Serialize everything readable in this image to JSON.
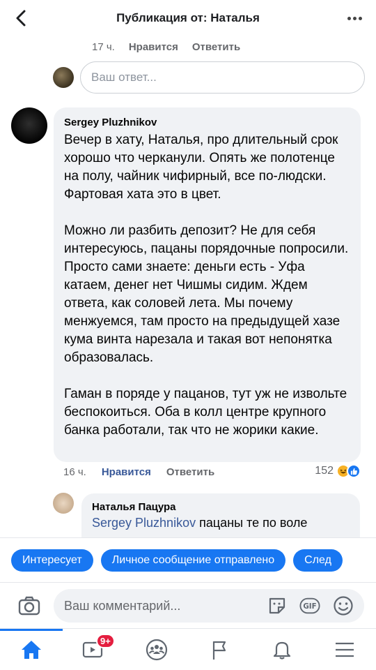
{
  "header": {
    "title": "Публикация от: Наталья"
  },
  "prev_comment_meta": {
    "time": "17 ч.",
    "like_label": "Нравится",
    "reply_label": "Ответить"
  },
  "reply_input": {
    "placeholder": "Ваш ответ..."
  },
  "main_comment": {
    "author": "Sergey Pluzhnikov",
    "paragraphs": [
      "Вечер в хату, Наталья, про длительный срок хорошо что черканули. Опять же полотенце на полу, чайник чифирный, все по-людски. Фартовая хата это в цвет.",
      "Можно ли разбить депозит? Не для себя интересуюсь, пацаны порядочные попросили. Просто сами знаете: деньги есть - Уфа катаем, денег нет Чишмы сидим. Ждем ответа, как соловей лета. Мы почему менжуемся, там просто на предыдущей хазе кума винта нарезала и такая вот непонятка образовалась.",
      "Гаман в поряде у пацанов, тут уж не извольте беспокоиться. Оба в колл центре крупного банка работали, так что не жорики какие."
    ],
    "time": "16 ч.",
    "like_label": "Нравится",
    "reply_label": "Ответить",
    "reaction_count": "152",
    "reactions": [
      "haha",
      "like"
    ]
  },
  "nested_reply": {
    "author": "Наталья Пацура",
    "mention": "Sergey Pluzhnikov",
    "text": "пацаны те по воле"
  },
  "chips": [
    "Интересует",
    "Личное сообщение отправлено",
    "След"
  ],
  "comment_bar": {
    "placeholder": "Ваш комментарий..."
  },
  "nav": {
    "items": [
      "home-icon",
      "watch-icon",
      "groups-icon",
      "pages-icon",
      "notifications-icon",
      "menu-icon"
    ],
    "watch_badge": "9+"
  },
  "colors": {
    "accent": "#1877f2",
    "link": "#385898",
    "bubble": "#f0f2f5",
    "badge": "#e41e3f"
  }
}
